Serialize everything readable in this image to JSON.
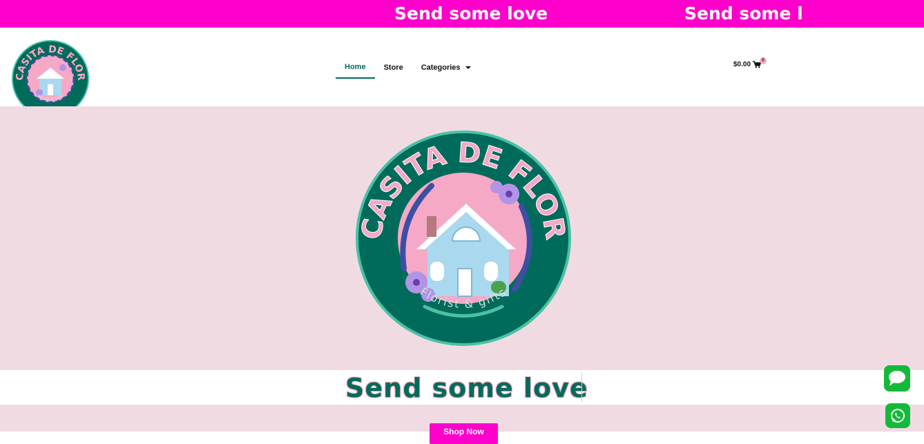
{
  "announcement": {
    "text": "Send some love",
    "text_repeat": "Send some l"
  },
  "nav": {
    "items": [
      {
        "label": "Home"
      },
      {
        "label": "Store"
      },
      {
        "label": "Categories"
      }
    ]
  },
  "cart": {
    "total": "$0.00",
    "count": "0"
  },
  "brand": {
    "name": "CASITA DE FLOR",
    "tagline": "Florist & gifts"
  },
  "headline": "Send some love",
  "cta": {
    "label": "Shop Now"
  },
  "colors": {
    "magenta": "#ff00cc",
    "teal": "#006b5b",
    "pink": "#f1dbe3",
    "green": "#14b93a"
  },
  "icons": {
    "cart": "cart-icon",
    "chat": "chat-icon",
    "whatsapp": "whatsapp-icon"
  }
}
